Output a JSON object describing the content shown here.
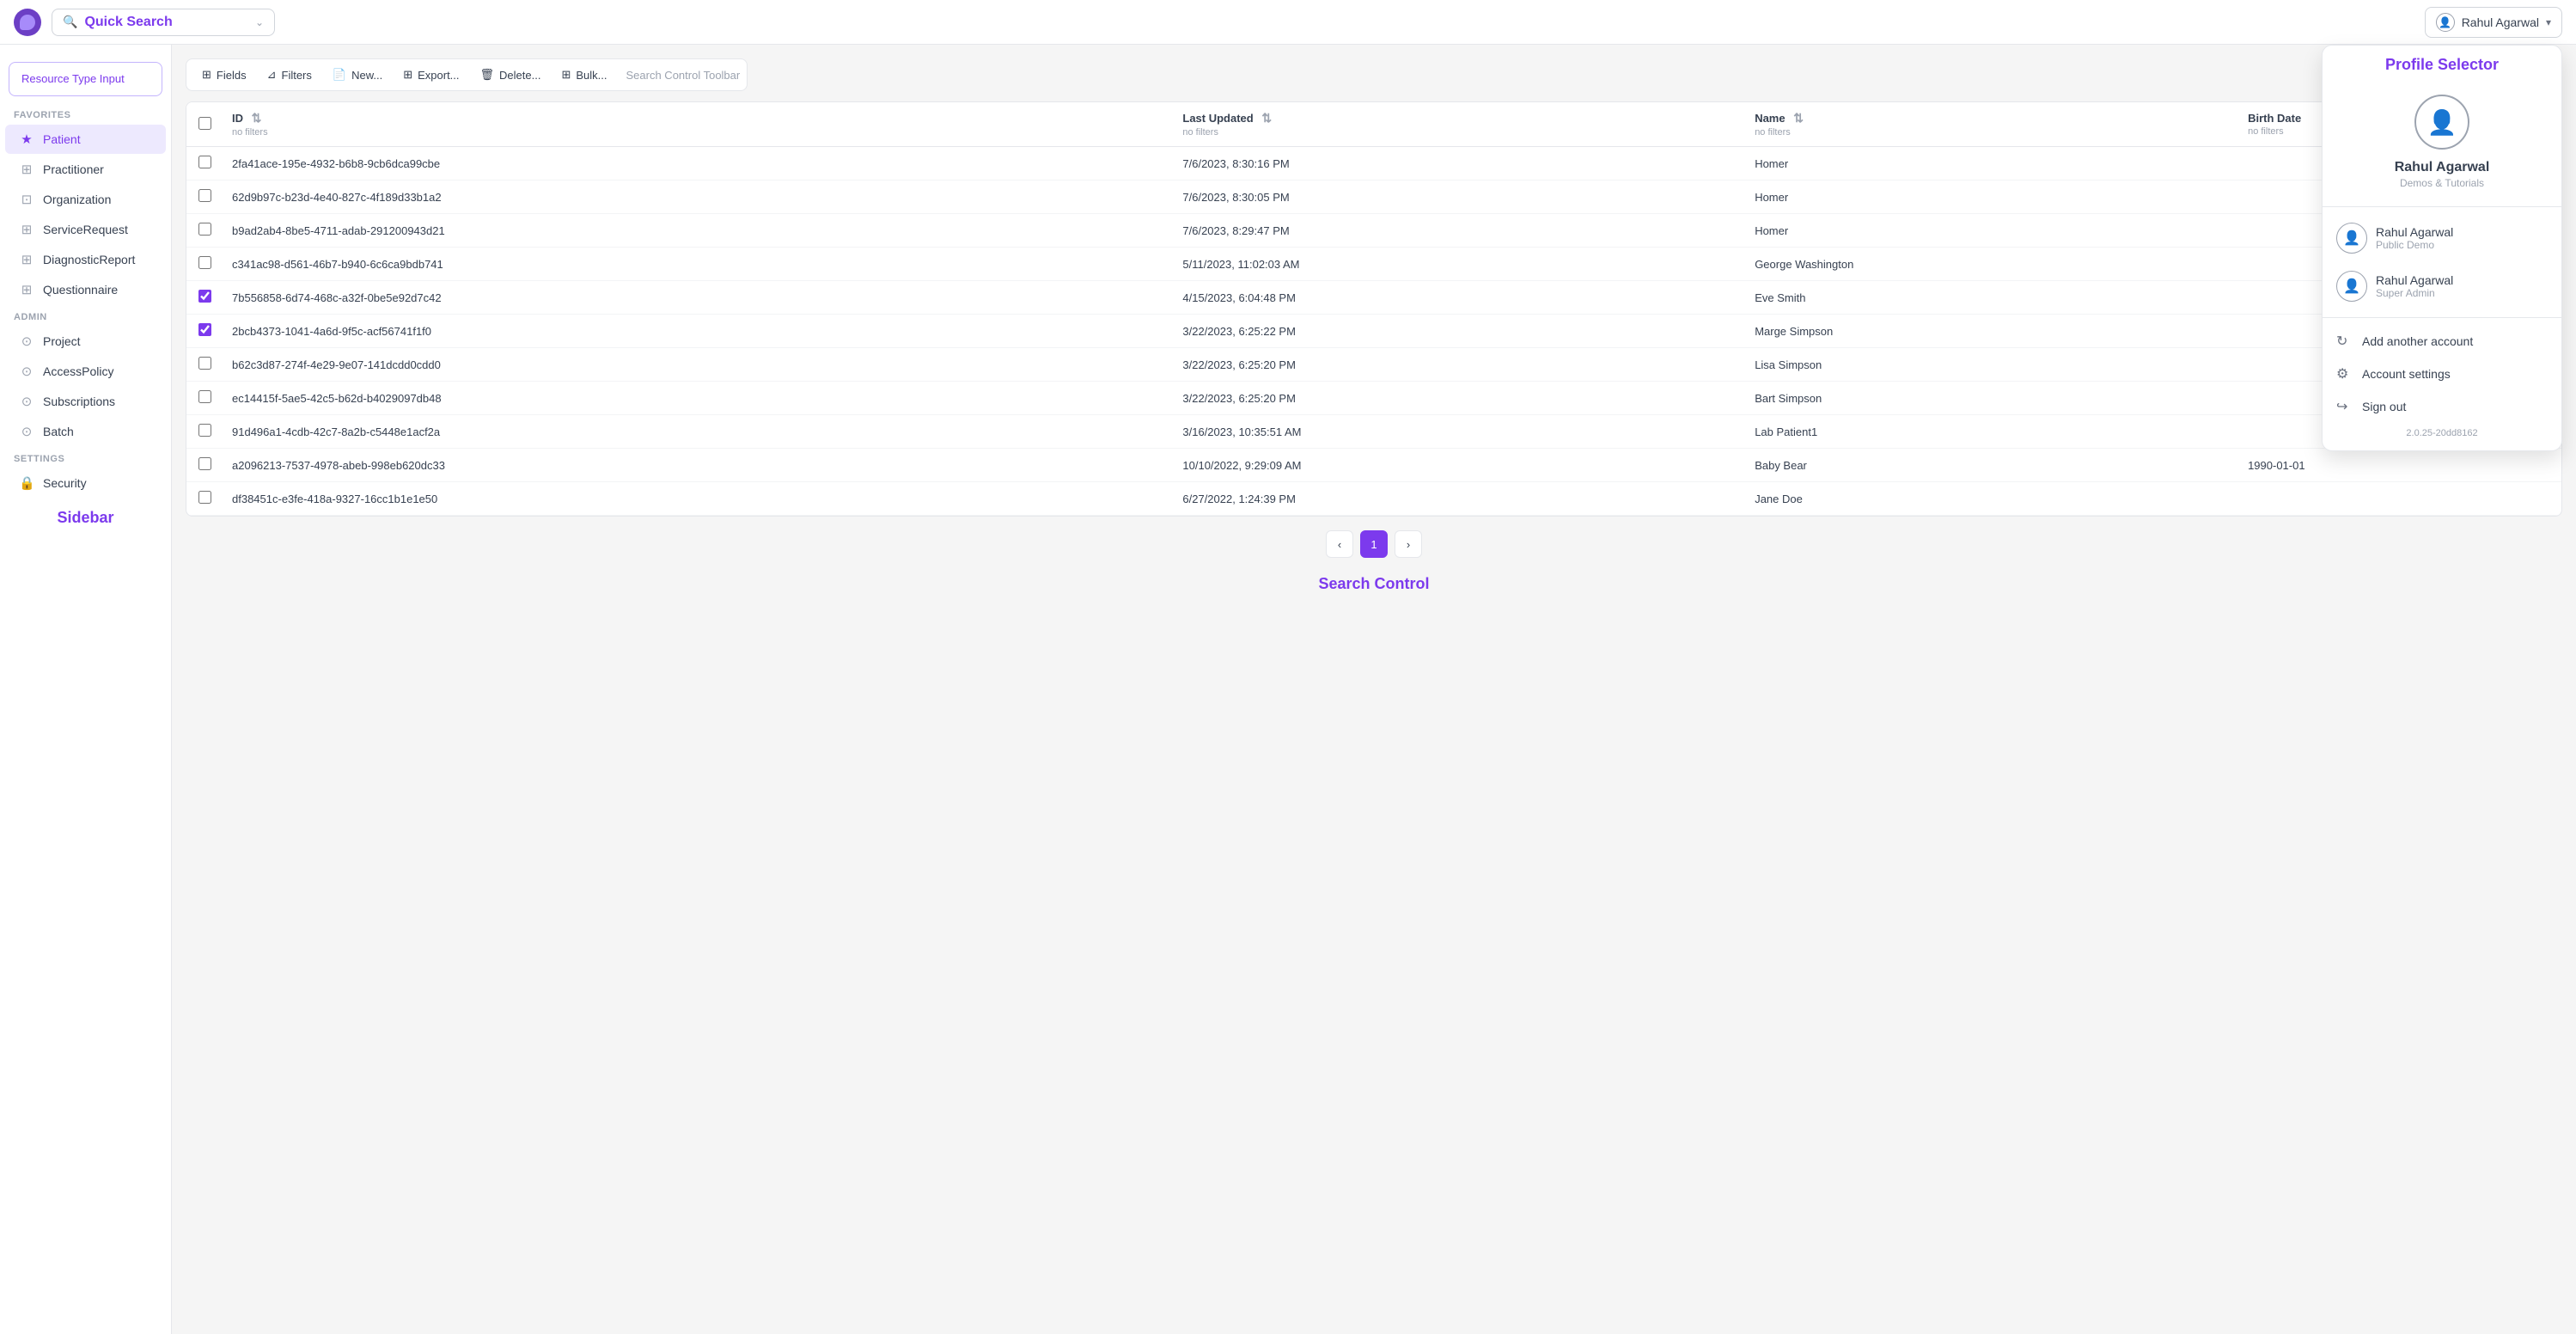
{
  "header": {
    "search_placeholder": "Quick Search",
    "user_name": "Rahul Agarwal",
    "user_chevron": "▾"
  },
  "sidebar": {
    "label": "Sidebar",
    "resource_type_input": "Resource Type Input",
    "sections": {
      "favorites_label": "FAVORITES",
      "admin_label": "ADMIN",
      "settings_label": "SETTINGS"
    },
    "favorites": [
      {
        "id": "patient",
        "label": "Patient",
        "icon": "★",
        "active": true
      },
      {
        "id": "practitioner",
        "label": "Practitioner",
        "icon": "⊞"
      },
      {
        "id": "organization",
        "label": "Organization",
        "icon": "⊡"
      },
      {
        "id": "service-request",
        "label": "ServiceRequest",
        "icon": "⊞"
      },
      {
        "id": "diagnostic-report",
        "label": "DiagnosticReport",
        "icon": "⊞"
      },
      {
        "id": "questionnaire",
        "label": "Questionnaire",
        "icon": "⊞"
      }
    ],
    "admin": [
      {
        "id": "project",
        "label": "Project",
        "icon": "⊙"
      },
      {
        "id": "access-policy",
        "label": "AccessPolicy",
        "icon": "⊙"
      },
      {
        "id": "subscriptions",
        "label": "Subscriptions",
        "icon": "⊙"
      },
      {
        "id": "batch",
        "label": "Batch",
        "icon": "⊙"
      }
    ],
    "settings": [
      {
        "id": "security",
        "label": "Security",
        "icon": "🔒"
      }
    ]
  },
  "toolbar": {
    "fields_label": "Fields",
    "filters_label": "Filters",
    "new_label": "New...",
    "export_label": "Export...",
    "delete_label": "Delete...",
    "bulk_label": "Bulk...",
    "search_control_toolbar": "Search Control Toolbar"
  },
  "table": {
    "columns": [
      {
        "id": "id",
        "label": "ID",
        "filter": "no filters"
      },
      {
        "id": "last-updated",
        "label": "Last Updated",
        "filter": "no filters"
      },
      {
        "id": "name",
        "label": "Name",
        "filter": "no filters"
      },
      {
        "id": "birth-date",
        "label": "Birth Date",
        "filter": "no filters"
      }
    ],
    "rows": [
      {
        "id": "2fa41ace-195e-4932-b6b8-9cb6dca99cbe",
        "last_updated": "7/6/2023, 8:30:16 PM",
        "name": "Homer",
        "birth_date": "",
        "checked": false
      },
      {
        "id": "62d9b97c-b23d-4e40-827c-4f189d33b1a2",
        "last_updated": "7/6/2023, 8:30:05 PM",
        "name": "Homer",
        "birth_date": "",
        "checked": false
      },
      {
        "id": "b9ad2ab4-8be5-4711-adab-291200943d21",
        "last_updated": "7/6/2023, 8:29:47 PM",
        "name": "Homer",
        "birth_date": "",
        "checked": false
      },
      {
        "id": "c341ac98-d561-46b7-b940-6c6ca9bdb741",
        "last_updated": "5/11/2023, 11:02:03 AM",
        "name": "George Washington",
        "birth_date": "",
        "checked": false
      },
      {
        "id": "7b556858-6d74-468c-a32f-0be5e92d7c42",
        "last_updated": "4/15/2023, 6:04:48 PM",
        "name": "Eve Smith",
        "birth_date": "",
        "checked": true
      },
      {
        "id": "2bcb4373-1041-4a6d-9f5c-acf56741f1f0",
        "last_updated": "3/22/2023, 6:25:22 PM",
        "name": "Marge Simpson",
        "birth_date": "",
        "checked": true
      },
      {
        "id": "b62c3d87-274f-4e29-9e07-141dcdd0cdd0",
        "last_updated": "3/22/2023, 6:25:20 PM",
        "name": "Lisa Simpson",
        "birth_date": "",
        "checked": false
      },
      {
        "id": "ec14415f-5ae5-42c5-b62d-b4029097db48",
        "last_updated": "3/22/2023, 6:25:20 PM",
        "name": "Bart Simpson",
        "birth_date": "",
        "checked": false
      },
      {
        "id": "91d496a1-4cdb-42c7-8a2b-c5448e1acf2a",
        "last_updated": "3/16/2023, 10:35:51 AM",
        "name": "Lab Patient1",
        "birth_date": "",
        "checked": false
      },
      {
        "id": "a2096213-7537-4978-abeb-998eb620dc33",
        "last_updated": "10/10/2022, 9:29:09 AM",
        "name": "Baby Bear",
        "birth_date": "1990-01-01",
        "checked": false
      },
      {
        "id": "df38451c-e3fe-418a-9327-16cc1b1e1e50",
        "last_updated": "6/27/2022, 1:24:39 PM",
        "name": "Jane Doe",
        "birth_date": "",
        "checked": false
      }
    ]
  },
  "pagination": {
    "prev_label": "‹",
    "next_label": "›",
    "current_page": "1"
  },
  "search_control_label": "Search Control",
  "profile_selector": {
    "title": "Profile Selector",
    "user": {
      "name": "Rahul Agarwal",
      "subtitle": "Demos & Tutorials"
    },
    "accounts": [
      {
        "name": "Rahul Agarwal",
        "role": "Public Demo"
      },
      {
        "name": "Rahul Agarwal",
        "role": "Super Admin"
      }
    ],
    "actions": [
      {
        "id": "add-account",
        "label": "Add another account",
        "icon": "↻"
      },
      {
        "id": "account-settings",
        "label": "Account settings",
        "icon": "⚙"
      },
      {
        "id": "sign-out",
        "label": "Sign out",
        "icon": "↪"
      }
    ],
    "version": "2.0.25-20dd8162"
  }
}
